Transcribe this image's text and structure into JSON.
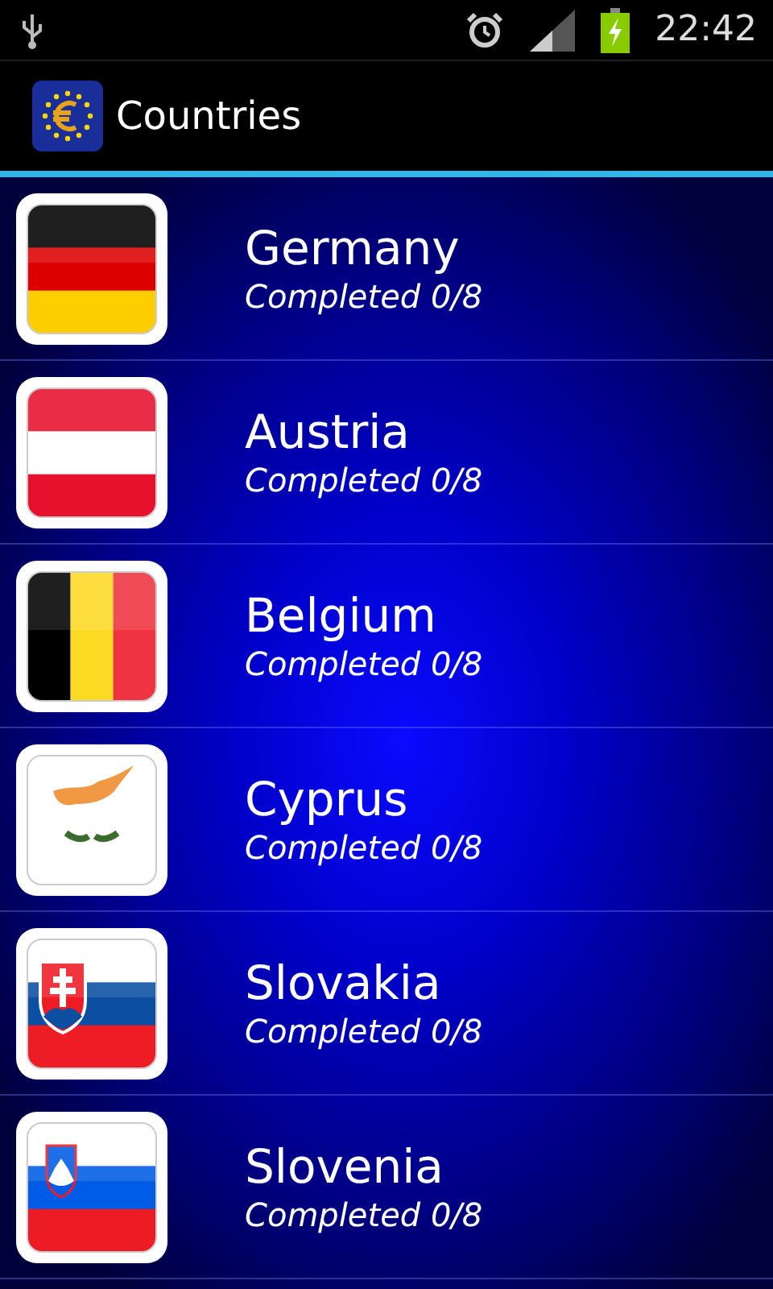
{
  "status_bar": {
    "time": "22:42"
  },
  "action_bar": {
    "title": "Countries"
  },
  "countries": [
    {
      "name": "Germany",
      "progress": "Completed 0/8",
      "kind": "germany"
    },
    {
      "name": "Austria",
      "progress": "Completed 0/8",
      "kind": "austria"
    },
    {
      "name": "Belgium",
      "progress": "Completed 0/8",
      "kind": "belgium"
    },
    {
      "name": "Cyprus",
      "progress": "Completed 0/8",
      "kind": "cyprus"
    },
    {
      "name": "Slovakia",
      "progress": "Completed 0/8",
      "kind": "slovakia"
    },
    {
      "name": "Slovenia",
      "progress": "Completed 0/8",
      "kind": "slovenia"
    }
  ]
}
